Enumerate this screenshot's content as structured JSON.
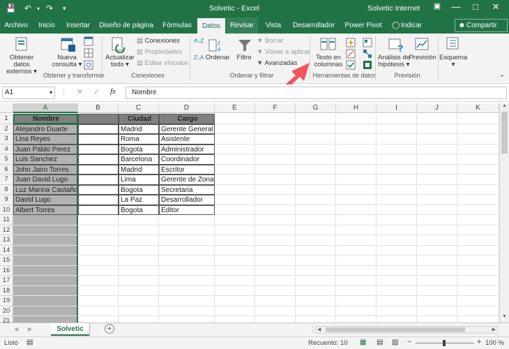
{
  "title": "Solvetic  -  Excel",
  "account": "Solvetic Internet",
  "tabs": [
    {
      "label": "Archivo"
    },
    {
      "label": "Inicio"
    },
    {
      "label": "Insertar"
    },
    {
      "label": "Diseño de página"
    },
    {
      "label": "Fórmulas"
    },
    {
      "label": "Datos"
    },
    {
      "label": "Revisar"
    },
    {
      "label": "Vista"
    },
    {
      "label": "Desarrollador"
    },
    {
      "label": "Power Pivot"
    },
    {
      "label": "Indicar"
    }
  ],
  "share_label": "Compartir",
  "ribbon": {
    "get_data": [
      "Obtener datos",
      "externos"
    ],
    "new_query": [
      "Nueva",
      "consulta"
    ],
    "refresh": [
      "Actualizar",
      "todo"
    ],
    "connections": "Conexiones",
    "properties": "Propiedades",
    "edit_links": "Editar vínculos",
    "sort": "Ordenar",
    "filter": "Filtro",
    "clear": "Borrar",
    "reapply": "Volver a aplicar",
    "advanced": "Avanzadas",
    "text_to_cols": [
      "Texto en",
      "columnas"
    ],
    "whatif": [
      "Análisis de",
      "hipótesis"
    ],
    "forecast": "Previsión",
    "outline": "Esquema",
    "groups": {
      "get_transform": "Obtener y transformar",
      "connections": "Conexiones",
      "sort_filter": "Ordenar y filtrar",
      "data_tools": "Herramientas de datos",
      "forecast": "Previsión"
    }
  },
  "namebox": "A1",
  "formula": "Nombre",
  "columns": [
    "A",
    "B",
    "C",
    "D",
    "E",
    "F",
    "G",
    "H",
    "I",
    "J",
    "K"
  ],
  "rows": [
    "1",
    "2",
    "3",
    "4",
    "5",
    "6",
    "7",
    "8",
    "9",
    "10",
    "11",
    "12",
    "13",
    "14",
    "15",
    "16",
    "17",
    "18",
    "19",
    "20",
    "21"
  ],
  "table": {
    "headers": {
      "name": "Nombre",
      "city": "Ciudad",
      "role": "Cargo"
    },
    "data": [
      {
        "name": "Alejandro Duarte",
        "city": "Madrid",
        "role": "Gerente General"
      },
      {
        "name": "Lina Reyes",
        "city": "Roma",
        "role": "Asistente"
      },
      {
        "name": "Juan Pablo Perez",
        "city": "Bogota",
        "role": "Administrador"
      },
      {
        "name": "Luis Sanchez",
        "city": "Barcelona",
        "role": "Coordinador"
      },
      {
        "name": "John Jairo Torres",
        "city": "Madrid",
        "role": "Escritor"
      },
      {
        "name": "Juan David Lugo",
        "city": "Lima",
        "role": "Gerente de Zona"
      },
      {
        "name": "Luz Marina Castaño",
        "city": "Bogota",
        "role": "Secretaria"
      },
      {
        "name": "David Lugo",
        "city": "La Paz",
        "role": "Desarrollador"
      },
      {
        "name": "Albert Torres",
        "city": "Bogota",
        "role": "Editor"
      }
    ]
  },
  "sheet_tab": "Solvetic",
  "status": {
    "ready": "Listo",
    "count": "Recuento: 10",
    "zoom": "100 %"
  },
  "colors": {
    "excel_green": "#217346",
    "arrow": "#f2545b"
  }
}
